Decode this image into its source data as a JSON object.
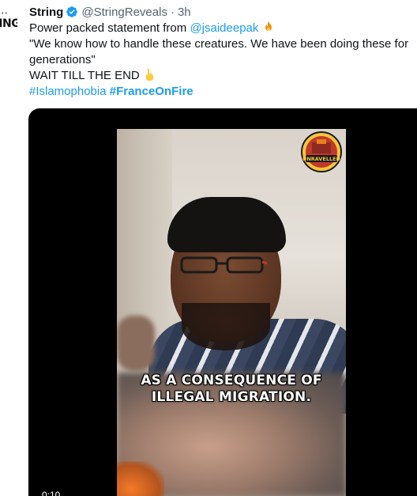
{
  "avatar": {
    "text": "RING"
  },
  "tweet": {
    "display_name": "String",
    "handle": "@StringReveals",
    "separator": "·",
    "time": "3h",
    "line1_prefix": "Power packed statement from ",
    "mention": "@jsaideepak",
    "line2": "\"We know how to handle these creatures. We have been doing these for",
    "line3": "generations\"",
    "line4": "WAIT TILL THE END",
    "hashtag1": "#Islamophobia",
    "hashtag2": "#FranceOnFire"
  },
  "video": {
    "caption_line1": "AS A CONSEQUENCE OF",
    "caption_line2": "ILLEGAL MIGRATION.",
    "timestamp": "0:10",
    "logo_text": "UNRAVELLED"
  },
  "colors": {
    "link": "#1d9bf0",
    "verified": "#1d9bf0",
    "muted": "#536471"
  }
}
